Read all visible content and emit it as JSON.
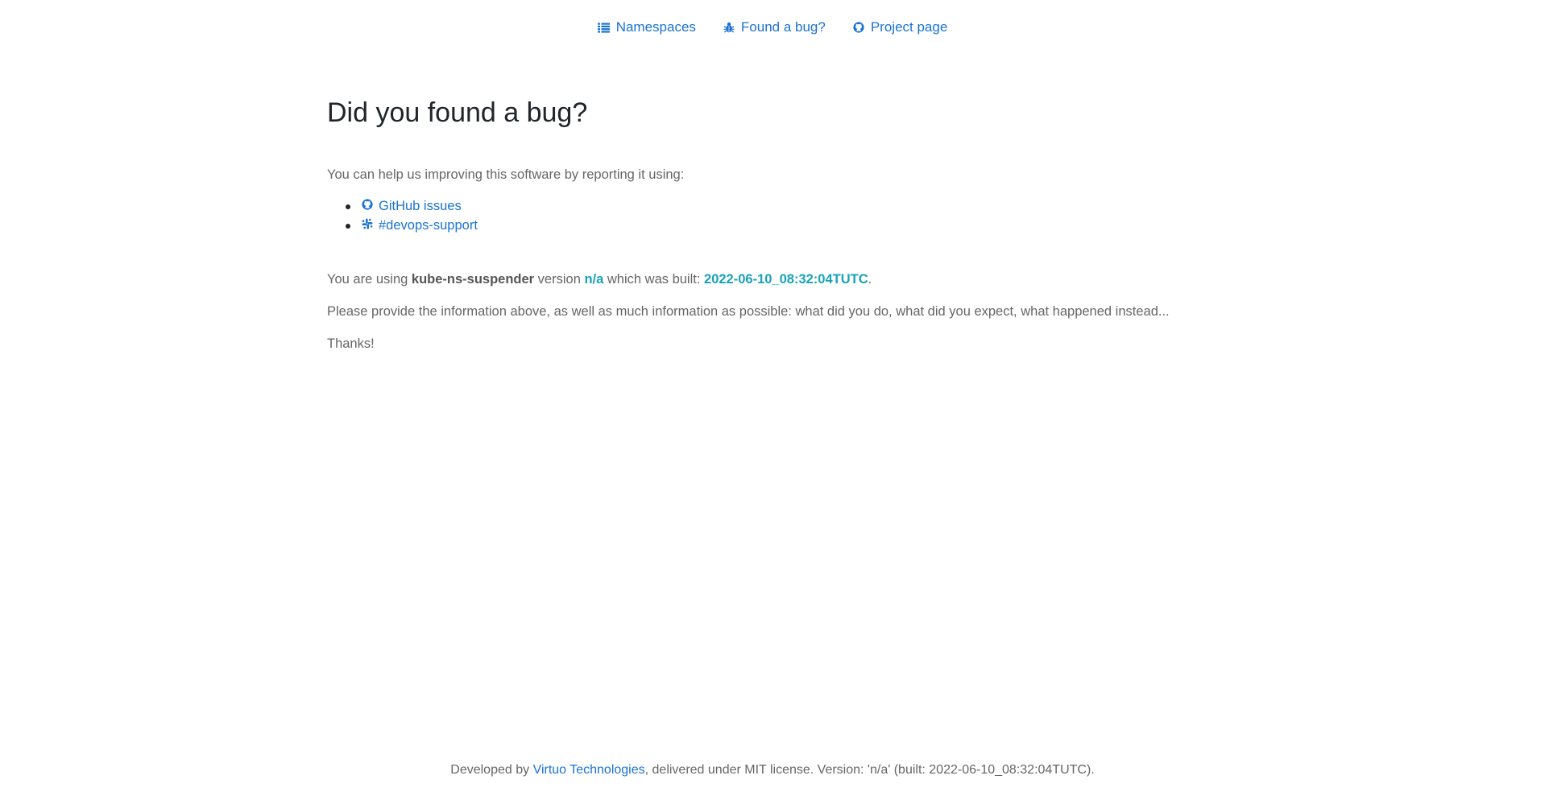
{
  "nav": {
    "items": [
      {
        "label": "Namespaces",
        "icon": "list-icon"
      },
      {
        "label": "Found a bug?",
        "icon": "bug-icon"
      },
      {
        "label": "Project page",
        "icon": "github-icon"
      }
    ]
  },
  "main": {
    "title": "Did you found a bug?",
    "intro": "You can help us improving this software by reporting it using:",
    "links": [
      {
        "label": "GitHub issues",
        "icon": "github-icon"
      },
      {
        "label": "#devops-support",
        "icon": "slack-icon"
      }
    ],
    "info": {
      "prefix": "You are using ",
      "app_name": "kube-ns-suspender",
      "version_label": " version ",
      "version": "n/a",
      "built_label": " which was built: ",
      "built": "2022-06-10_08:32:04TUTC",
      "suffix": "."
    },
    "request": "Please provide the information above, as well as much information as possible: what did you do, what did you expect, what happened instead...",
    "thanks": "Thanks!"
  },
  "footer": {
    "prefix": "Developed by ",
    "company": "Virtuo Technologies",
    "suffix": ", delivered under MIT license. Version: 'n/a' (built: 2022-06-10_08:32:04TUTC)."
  },
  "colors": {
    "link": "#1a73d2",
    "highlight": "#17a2b8",
    "text": "#666666",
    "heading": "#212529"
  }
}
